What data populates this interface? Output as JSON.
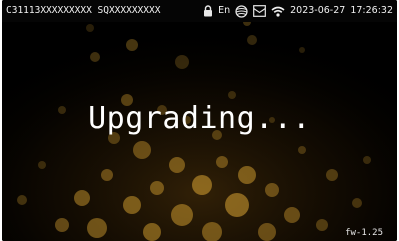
{
  "status_bar": {
    "device_ids": "C31113XXXXXXXXX  SQXXXXXXXXX",
    "language": "En",
    "date": "2023-06-27",
    "time": "17:26:32",
    "icons": [
      "lock-icon",
      "globe-icon",
      "message-icon",
      "wifi-icon"
    ]
  },
  "main": {
    "message": "Upgrading..."
  },
  "footer": {
    "firmware": "fw-1.25"
  },
  "colors": {
    "background": "#000000",
    "bokeh": "#c9972e",
    "text": "#ffffff"
  }
}
